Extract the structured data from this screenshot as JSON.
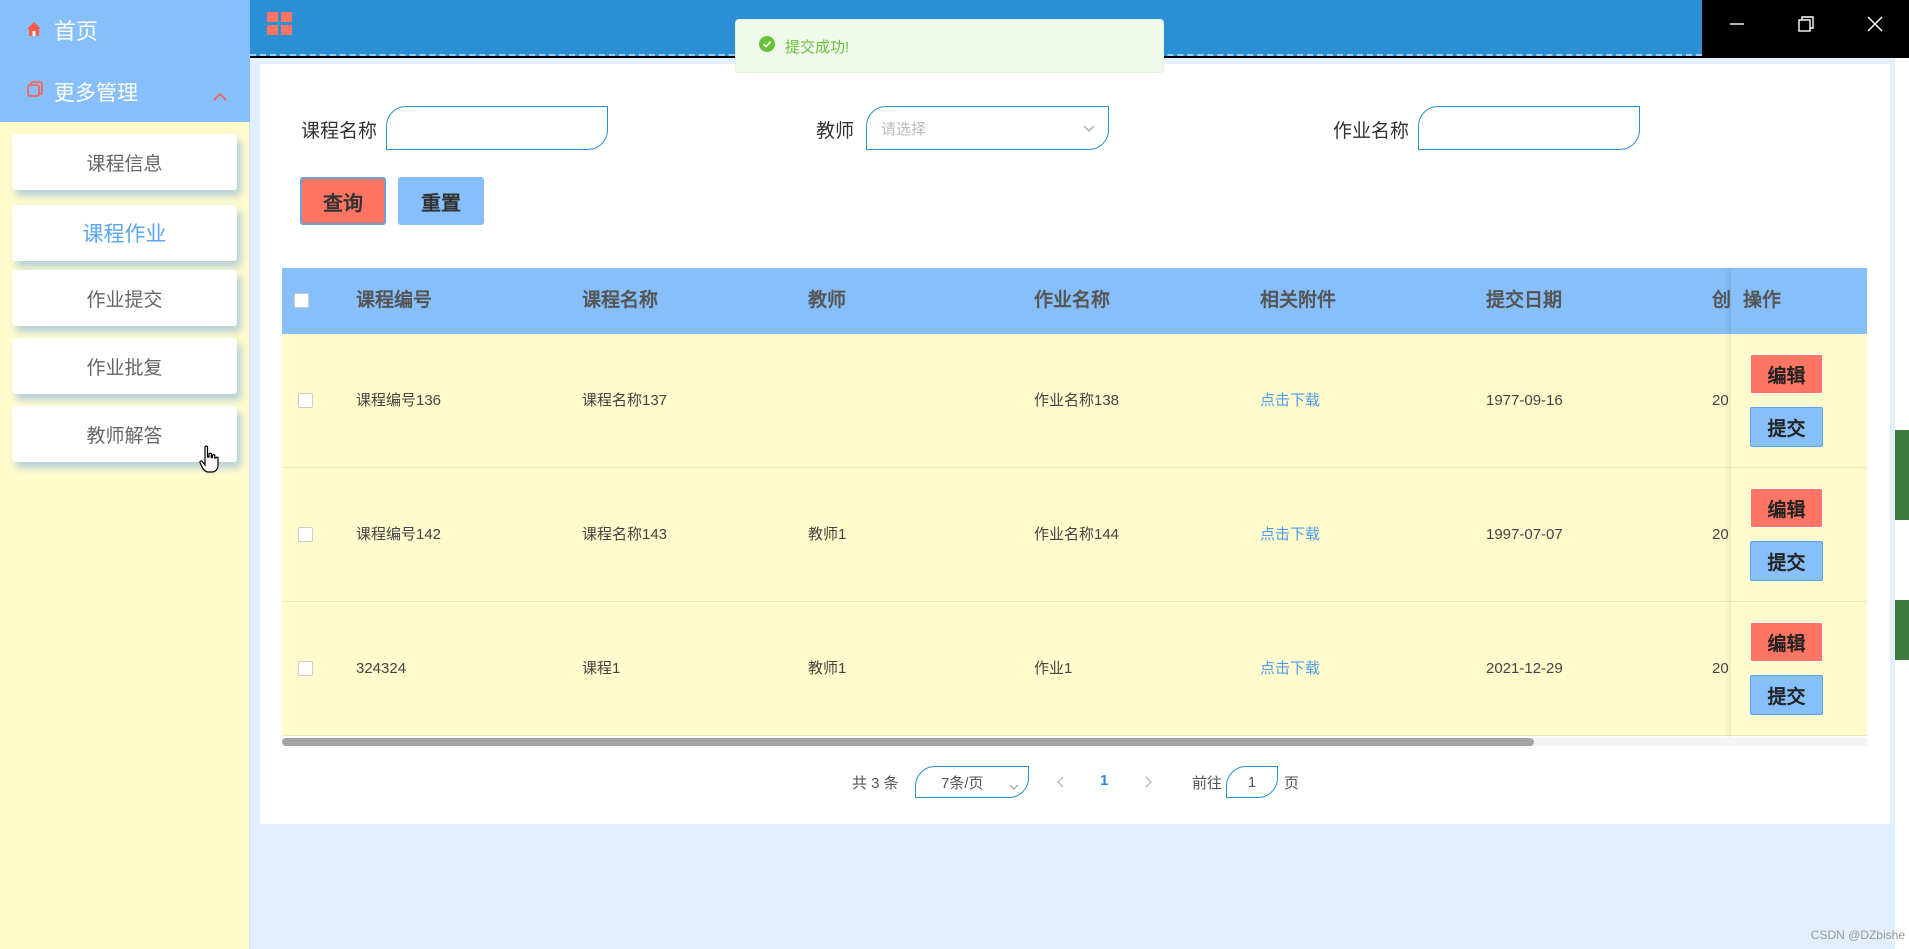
{
  "sidebar": {
    "home_label": "首页",
    "more_label": "更多管理",
    "items": [
      {
        "label": "课程信息"
      },
      {
        "label": "课程作业"
      },
      {
        "label": "作业提交"
      },
      {
        "label": "作业批复"
      },
      {
        "label": "教师解答"
      }
    ],
    "active_item": "课程作业"
  },
  "toast": {
    "message": "提交成功!"
  },
  "filters": {
    "course_name_label": "课程名称",
    "course_name_value": "",
    "teacher_label": "教师",
    "teacher_placeholder": "请选择",
    "homework_name_label": "作业名称",
    "homework_name_value": ""
  },
  "actions": {
    "query_label": "查询",
    "reset_label": "重置"
  },
  "table": {
    "headers": [
      "课程编号",
      "课程名称",
      "教师",
      "作业名称",
      "相关附件",
      "提交日期",
      "创",
      "操作"
    ],
    "rows": [
      {
        "course_no": "课程编号136",
        "course_name": "课程名称137",
        "teacher": "",
        "homework": "作业名称138",
        "attachment": "点击下载",
        "date": "1977-09-16",
        "created": "20"
      },
      {
        "course_no": "课程编号142",
        "course_name": "课程名称143",
        "teacher": "教师1",
        "homework": "作业名称144",
        "attachment": "点击下载",
        "date": "1997-07-07",
        "created": "20"
      },
      {
        "course_no": "324324",
        "course_name": "课程1",
        "teacher": "教师1",
        "homework": "作业1",
        "attachment": "点击下载",
        "date": "2021-12-29",
        "created": "20"
      }
    ],
    "edit_label": "编辑",
    "submit_label": "提交"
  },
  "pager": {
    "total": "共 3 条",
    "page_size": "7条/页",
    "current_page": "1",
    "goto_label": "前往",
    "goto_value": "1",
    "page_suffix": "页"
  },
  "watermark": "CSDN @DZbishe",
  "colors": {
    "accent": "#86bff9",
    "danger": "#ff7563",
    "topbar": "#2b8fd6",
    "row_bg": "#fffbcc"
  }
}
